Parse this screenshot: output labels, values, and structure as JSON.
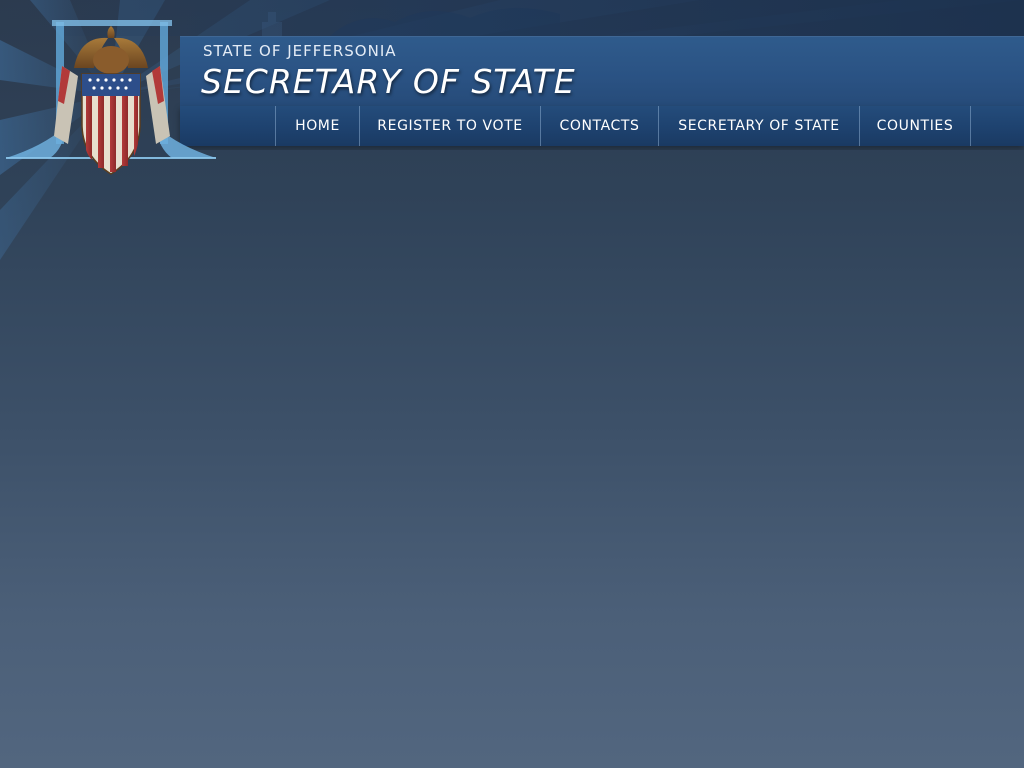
{
  "header": {
    "state_label": "STATE OF JEFFERSONIA",
    "site_title": "SECRETARY OF STATE"
  },
  "nav": {
    "items": [
      {
        "label": "HOME"
      },
      {
        "label": "REGISTER TO VOTE"
      },
      {
        "label": "CONTACTS"
      },
      {
        "label": "SECRETARY OF STATE"
      },
      {
        "label": "COUNTIES"
      }
    ]
  },
  "icons": {
    "seal": "eagle-shield-seal-icon"
  },
  "colors": {
    "header_blue": "#2a5283",
    "nav_blue": "#1e426f",
    "page_top": "#2c3b4f",
    "page_bottom": "#52667f"
  }
}
